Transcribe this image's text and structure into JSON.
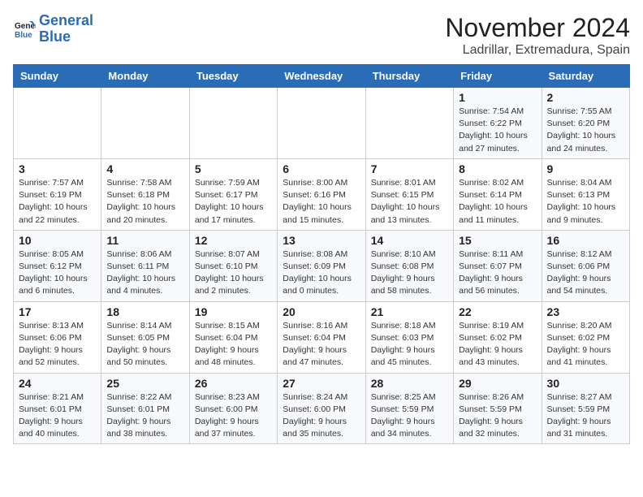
{
  "header": {
    "logo_line1": "General",
    "logo_line2": "Blue",
    "title": "November 2024",
    "location": "Ladrillar, Extremadura, Spain"
  },
  "calendar": {
    "days_of_week": [
      "Sunday",
      "Monday",
      "Tuesday",
      "Wednesday",
      "Thursday",
      "Friday",
      "Saturday"
    ],
    "weeks": [
      [
        {
          "day": "",
          "info": ""
        },
        {
          "day": "",
          "info": ""
        },
        {
          "day": "",
          "info": ""
        },
        {
          "day": "",
          "info": ""
        },
        {
          "day": "",
          "info": ""
        },
        {
          "day": "1",
          "info": "Sunrise: 7:54 AM\nSunset: 6:22 PM\nDaylight: 10 hours and 27 minutes."
        },
        {
          "day": "2",
          "info": "Sunrise: 7:55 AM\nSunset: 6:20 PM\nDaylight: 10 hours and 24 minutes."
        }
      ],
      [
        {
          "day": "3",
          "info": "Sunrise: 7:57 AM\nSunset: 6:19 PM\nDaylight: 10 hours and 22 minutes."
        },
        {
          "day": "4",
          "info": "Sunrise: 7:58 AM\nSunset: 6:18 PM\nDaylight: 10 hours and 20 minutes."
        },
        {
          "day": "5",
          "info": "Sunrise: 7:59 AM\nSunset: 6:17 PM\nDaylight: 10 hours and 17 minutes."
        },
        {
          "day": "6",
          "info": "Sunrise: 8:00 AM\nSunset: 6:16 PM\nDaylight: 10 hours and 15 minutes."
        },
        {
          "day": "7",
          "info": "Sunrise: 8:01 AM\nSunset: 6:15 PM\nDaylight: 10 hours and 13 minutes."
        },
        {
          "day": "8",
          "info": "Sunrise: 8:02 AM\nSunset: 6:14 PM\nDaylight: 10 hours and 11 minutes."
        },
        {
          "day": "9",
          "info": "Sunrise: 8:04 AM\nSunset: 6:13 PM\nDaylight: 10 hours and 9 minutes."
        }
      ],
      [
        {
          "day": "10",
          "info": "Sunrise: 8:05 AM\nSunset: 6:12 PM\nDaylight: 10 hours and 6 minutes."
        },
        {
          "day": "11",
          "info": "Sunrise: 8:06 AM\nSunset: 6:11 PM\nDaylight: 10 hours and 4 minutes."
        },
        {
          "day": "12",
          "info": "Sunrise: 8:07 AM\nSunset: 6:10 PM\nDaylight: 10 hours and 2 minutes."
        },
        {
          "day": "13",
          "info": "Sunrise: 8:08 AM\nSunset: 6:09 PM\nDaylight: 10 hours and 0 minutes."
        },
        {
          "day": "14",
          "info": "Sunrise: 8:10 AM\nSunset: 6:08 PM\nDaylight: 9 hours and 58 minutes."
        },
        {
          "day": "15",
          "info": "Sunrise: 8:11 AM\nSunset: 6:07 PM\nDaylight: 9 hours and 56 minutes."
        },
        {
          "day": "16",
          "info": "Sunrise: 8:12 AM\nSunset: 6:06 PM\nDaylight: 9 hours and 54 minutes."
        }
      ],
      [
        {
          "day": "17",
          "info": "Sunrise: 8:13 AM\nSunset: 6:06 PM\nDaylight: 9 hours and 52 minutes."
        },
        {
          "day": "18",
          "info": "Sunrise: 8:14 AM\nSunset: 6:05 PM\nDaylight: 9 hours and 50 minutes."
        },
        {
          "day": "19",
          "info": "Sunrise: 8:15 AM\nSunset: 6:04 PM\nDaylight: 9 hours and 48 minutes."
        },
        {
          "day": "20",
          "info": "Sunrise: 8:16 AM\nSunset: 6:04 PM\nDaylight: 9 hours and 47 minutes."
        },
        {
          "day": "21",
          "info": "Sunrise: 8:18 AM\nSunset: 6:03 PM\nDaylight: 9 hours and 45 minutes."
        },
        {
          "day": "22",
          "info": "Sunrise: 8:19 AM\nSunset: 6:02 PM\nDaylight: 9 hours and 43 minutes."
        },
        {
          "day": "23",
          "info": "Sunrise: 8:20 AM\nSunset: 6:02 PM\nDaylight: 9 hours and 41 minutes."
        }
      ],
      [
        {
          "day": "24",
          "info": "Sunrise: 8:21 AM\nSunset: 6:01 PM\nDaylight: 9 hours and 40 minutes."
        },
        {
          "day": "25",
          "info": "Sunrise: 8:22 AM\nSunset: 6:01 PM\nDaylight: 9 hours and 38 minutes."
        },
        {
          "day": "26",
          "info": "Sunrise: 8:23 AM\nSunset: 6:00 PM\nDaylight: 9 hours and 37 minutes."
        },
        {
          "day": "27",
          "info": "Sunrise: 8:24 AM\nSunset: 6:00 PM\nDaylight: 9 hours and 35 minutes."
        },
        {
          "day": "28",
          "info": "Sunrise: 8:25 AM\nSunset: 5:59 PM\nDaylight: 9 hours and 34 minutes."
        },
        {
          "day": "29",
          "info": "Sunrise: 8:26 AM\nSunset: 5:59 PM\nDaylight: 9 hours and 32 minutes."
        },
        {
          "day": "30",
          "info": "Sunrise: 8:27 AM\nSunset: 5:59 PM\nDaylight: 9 hours and 31 minutes."
        }
      ]
    ]
  }
}
